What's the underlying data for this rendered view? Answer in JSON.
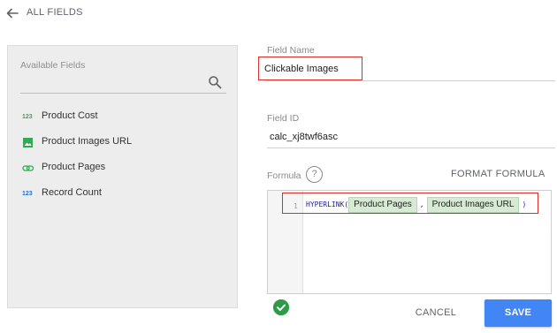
{
  "header": {
    "back_label": "ALL FIELDS"
  },
  "available_fields": {
    "title": "Available Fields",
    "items": [
      {
        "icon": "number-icon",
        "icon_text": "123",
        "label": "Product Cost"
      },
      {
        "icon": "image-icon",
        "icon_text": "",
        "label": "Product Images URL"
      },
      {
        "icon": "link-icon",
        "icon_text": "",
        "label": "Product Pages"
      },
      {
        "icon": "number-icon",
        "icon_text": "123",
        "label": "Record Count"
      }
    ]
  },
  "field_name": {
    "label": "Field Name",
    "value": "Clickable Images"
  },
  "field_id": {
    "label": "Field ID",
    "value": "calc_xj8twf6asc"
  },
  "formula": {
    "label": "Formula",
    "format_label": "FORMAT FORMULA",
    "line_number": "1",
    "function": "HYPERLINK(",
    "arg1": "Product Pages",
    "separator": ",",
    "arg2": "Product Images URL",
    "close": ")"
  },
  "actions": {
    "cancel_label": "CANCEL",
    "save_label": "SAVE"
  },
  "colors": {
    "accent": "#4285f4",
    "valid": "#2e9b47",
    "highlight": "#d93025",
    "chip": "#d7ead3"
  }
}
